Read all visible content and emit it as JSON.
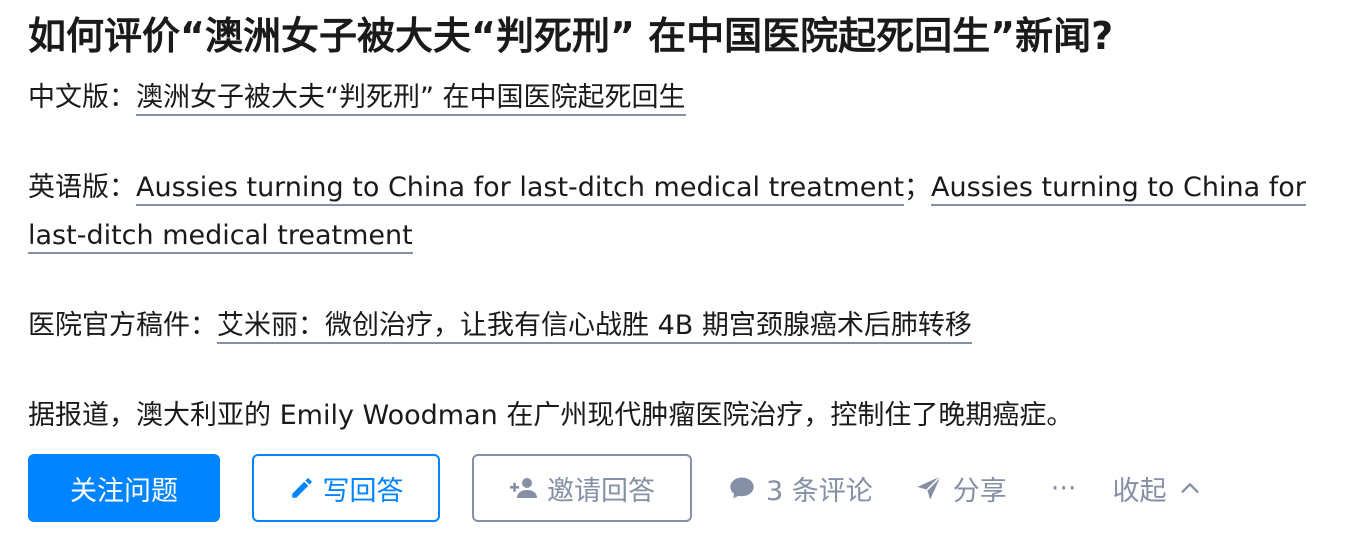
{
  "question": {
    "title": "如何评价“澳洲女子被大夫“判死刑” 在中国医院起死回生”新闻?"
  },
  "detail": {
    "chinese": {
      "label": "中文版：",
      "link": "澳洲女子被大夫“判死刑” 在中国医院起死回生"
    },
    "english": {
      "label": "英语版：",
      "link1": "Aussies turning to China for last-ditch medical treatment",
      "separator": "；",
      "link2": "Aussies turning to China for last-ditch medical treatment"
    },
    "official": {
      "label": "医院官方稿件：",
      "link": "艾米丽：微创治疗，让我有信心战胜 4B 期宫颈腺癌术后肺转移"
    },
    "summary": "据报道，澳大利亚的 Emily Woodman 在广州现代肿瘤医院治疗，控制住了晚期癌症。"
  },
  "actions": {
    "follow": "关注问题",
    "write": "写回答",
    "invite": "邀请回答",
    "comments": "3 条评论",
    "share": "分享",
    "more": "···",
    "collapse": "收起"
  },
  "colors": {
    "primary": "#0084ff",
    "muted": "#8590a6",
    "text": "#1a1a1a"
  }
}
